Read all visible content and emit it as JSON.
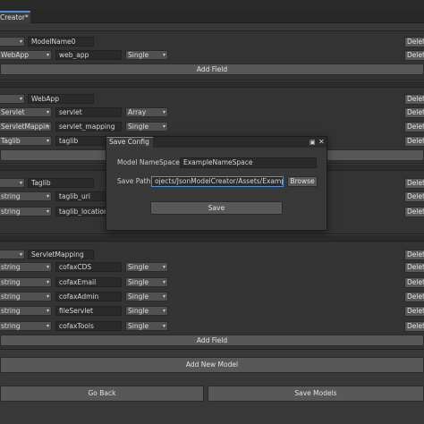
{
  "window": {
    "title": "",
    "tab": "Creator*"
  },
  "models": [
    {
      "name": "ModelName0",
      "fields": [
        {
          "type": "WebApp",
          "name": "web_app",
          "collection": "Single"
        }
      ]
    },
    {
      "name": "WebApp",
      "fields": [
        {
          "type": "Servlet",
          "name": "servlet",
          "collection": "Array"
        },
        {
          "type": "ServletMappin",
          "name": "servlet_mapping",
          "collection": "Single"
        },
        {
          "type": "Taglib",
          "name": "taglib",
          "collection": "Single"
        }
      ]
    },
    {
      "name": "Taglib",
      "fields": [
        {
          "type": "string",
          "name": "taglib_uri"
        },
        {
          "type": "string",
          "name": "taglib_location"
        }
      ]
    },
    {
      "name": "ServletMapping",
      "fields": [
        {
          "type": "string",
          "name": "cofaxCDS",
          "collection": "Single"
        },
        {
          "type": "string",
          "name": "cofaxEmail",
          "collection": "Single"
        },
        {
          "type": "string",
          "name": "cofaxAdmin",
          "collection": "Single"
        },
        {
          "type": "string",
          "name": "fileServlet",
          "collection": "Single"
        },
        {
          "type": "string",
          "name": "cofaxTools",
          "collection": "Single"
        }
      ]
    }
  ],
  "labels": {
    "add_field": "Add Field",
    "delete": "Delete",
    "add_new_model": "Add New Model",
    "go_back": "Go Back",
    "save_models": "Save Models"
  },
  "dialog": {
    "title": "Save Config",
    "namespace_label": "Model NameSpace",
    "namespace_value": "ExampleNameSpace",
    "path_label": "Save Path",
    "path_value": "ojects/JsonModelCreator/Assets/Example",
    "browse": "Browse",
    "save": "Save"
  },
  "icons": {
    "maximize": "window-maximize-icon",
    "close": "close-icon",
    "dropdown": "chevron-down-icon"
  },
  "colors": {
    "accent": "#4d8fd8",
    "panel": "#333333",
    "background": "#383838",
    "button": "#585858"
  }
}
